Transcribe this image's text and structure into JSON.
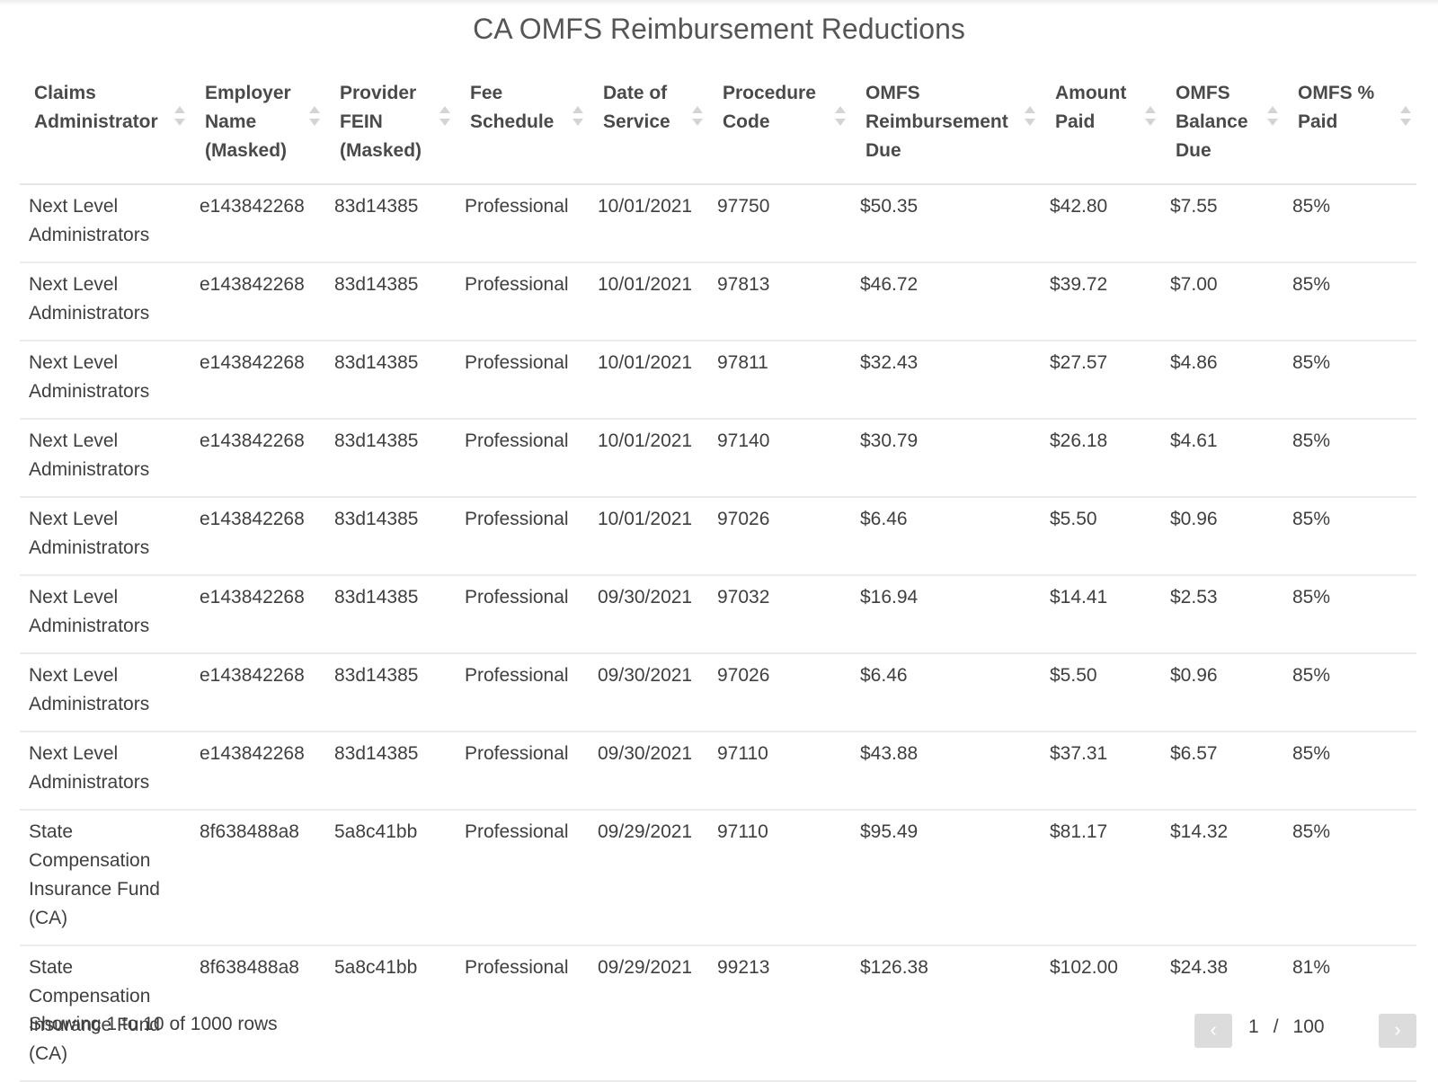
{
  "title": "CA OMFS Reimbursement Reductions",
  "columns": [
    "Claims Administrator",
    "Employer Name (Masked)",
    "Provider FEIN (Masked)",
    "Fee Schedule",
    "Date of Service",
    "Procedure Code",
    "OMFS Reimbursement Due",
    "Amount Paid",
    "OMFS Balance Due",
    "OMFS % Paid"
  ],
  "rows": [
    [
      "Next Level Administrators",
      "e143842268",
      "83d14385",
      "Professional",
      "10/01/2021",
      "97750",
      "$50.35",
      "$42.80",
      "$7.55",
      "85%"
    ],
    [
      "Next Level Administrators",
      "e143842268",
      "83d14385",
      "Professional",
      "10/01/2021",
      "97813",
      "$46.72",
      "$39.72",
      "$7.00",
      "85%"
    ],
    [
      "Next Level Administrators",
      "e143842268",
      "83d14385",
      "Professional",
      "10/01/2021",
      "97811",
      "$32.43",
      "$27.57",
      "$4.86",
      "85%"
    ],
    [
      "Next Level Administrators",
      "e143842268",
      "83d14385",
      "Professional",
      "10/01/2021",
      "97140",
      "$30.79",
      "$26.18",
      "$4.61",
      "85%"
    ],
    [
      "Next Level Administrators",
      "e143842268",
      "83d14385",
      "Professional",
      "10/01/2021",
      "97026",
      "$6.46",
      "$5.50",
      "$0.96",
      "85%"
    ],
    [
      "Next Level Administrators",
      "e143842268",
      "83d14385",
      "Professional",
      "09/30/2021",
      "97032",
      "$16.94",
      "$14.41",
      "$2.53",
      "85%"
    ],
    [
      "Next Level Administrators",
      "e143842268",
      "83d14385",
      "Professional",
      "09/30/2021",
      "97026",
      "$6.46",
      "$5.50",
      "$0.96",
      "85%"
    ],
    [
      "Next Level Administrators",
      "e143842268",
      "83d14385",
      "Professional",
      "09/30/2021",
      "97110",
      "$43.88",
      "$37.31",
      "$6.57",
      "85%"
    ],
    [
      "State Compensation Insurance Fund (CA)",
      "8f638488a8",
      "5a8c41bb",
      "Professional",
      "09/29/2021",
      "97110",
      "$95.49",
      "$81.17",
      "$14.32",
      "85%"
    ],
    [
      "State Compensation Insurance Fund (CA)",
      "8f638488a8",
      "5a8c41bb",
      "Professional",
      "09/29/2021",
      "99213",
      "$126.38",
      "$102.00",
      "$24.38",
      "81%"
    ]
  ],
  "footer": {
    "rows_info": "Showing 1 to 10 of 1000 rows",
    "current_page": "1",
    "separator": "/",
    "total_pages": "100",
    "prev_icon": "chevron-left-icon",
    "next_icon": "chevron-right-icon"
  }
}
